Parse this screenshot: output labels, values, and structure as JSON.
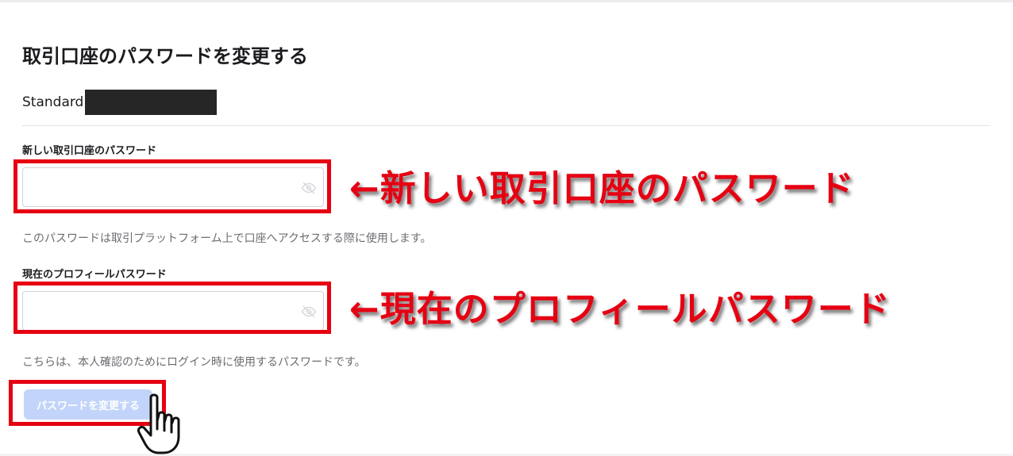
{
  "page": {
    "title": "取引口座のパスワードを変更する",
    "account_type": "Standard"
  },
  "fields": {
    "new_password": {
      "label": "新しい取引口座のパスワード",
      "value": "",
      "placeholder": "",
      "hint": "このパスワードは取引プラットフォーム上で口座へアクセスする際に使用します。"
    },
    "current_password": {
      "label": "現在のプロフィールパスワード",
      "value": "",
      "placeholder": "",
      "hint": "こちらは、本人確認のためにログイン時に使用するパスワードです。"
    }
  },
  "actions": {
    "submit_label": "パスワードを変更する"
  },
  "annotations": {
    "new_password": "←新しい取引口座のパスワード",
    "current_password": "←現在のプロフィールパスワード"
  },
  "icons": {
    "visibility_toggle": "eye-off-icon",
    "pointer": "pointing-hand-icon"
  },
  "colors": {
    "annotation_red": "#e60012",
    "button_disabled_blue": "#c2d4f9",
    "text_primary": "#1b1b1f",
    "text_hint": "#6c6c72"
  }
}
